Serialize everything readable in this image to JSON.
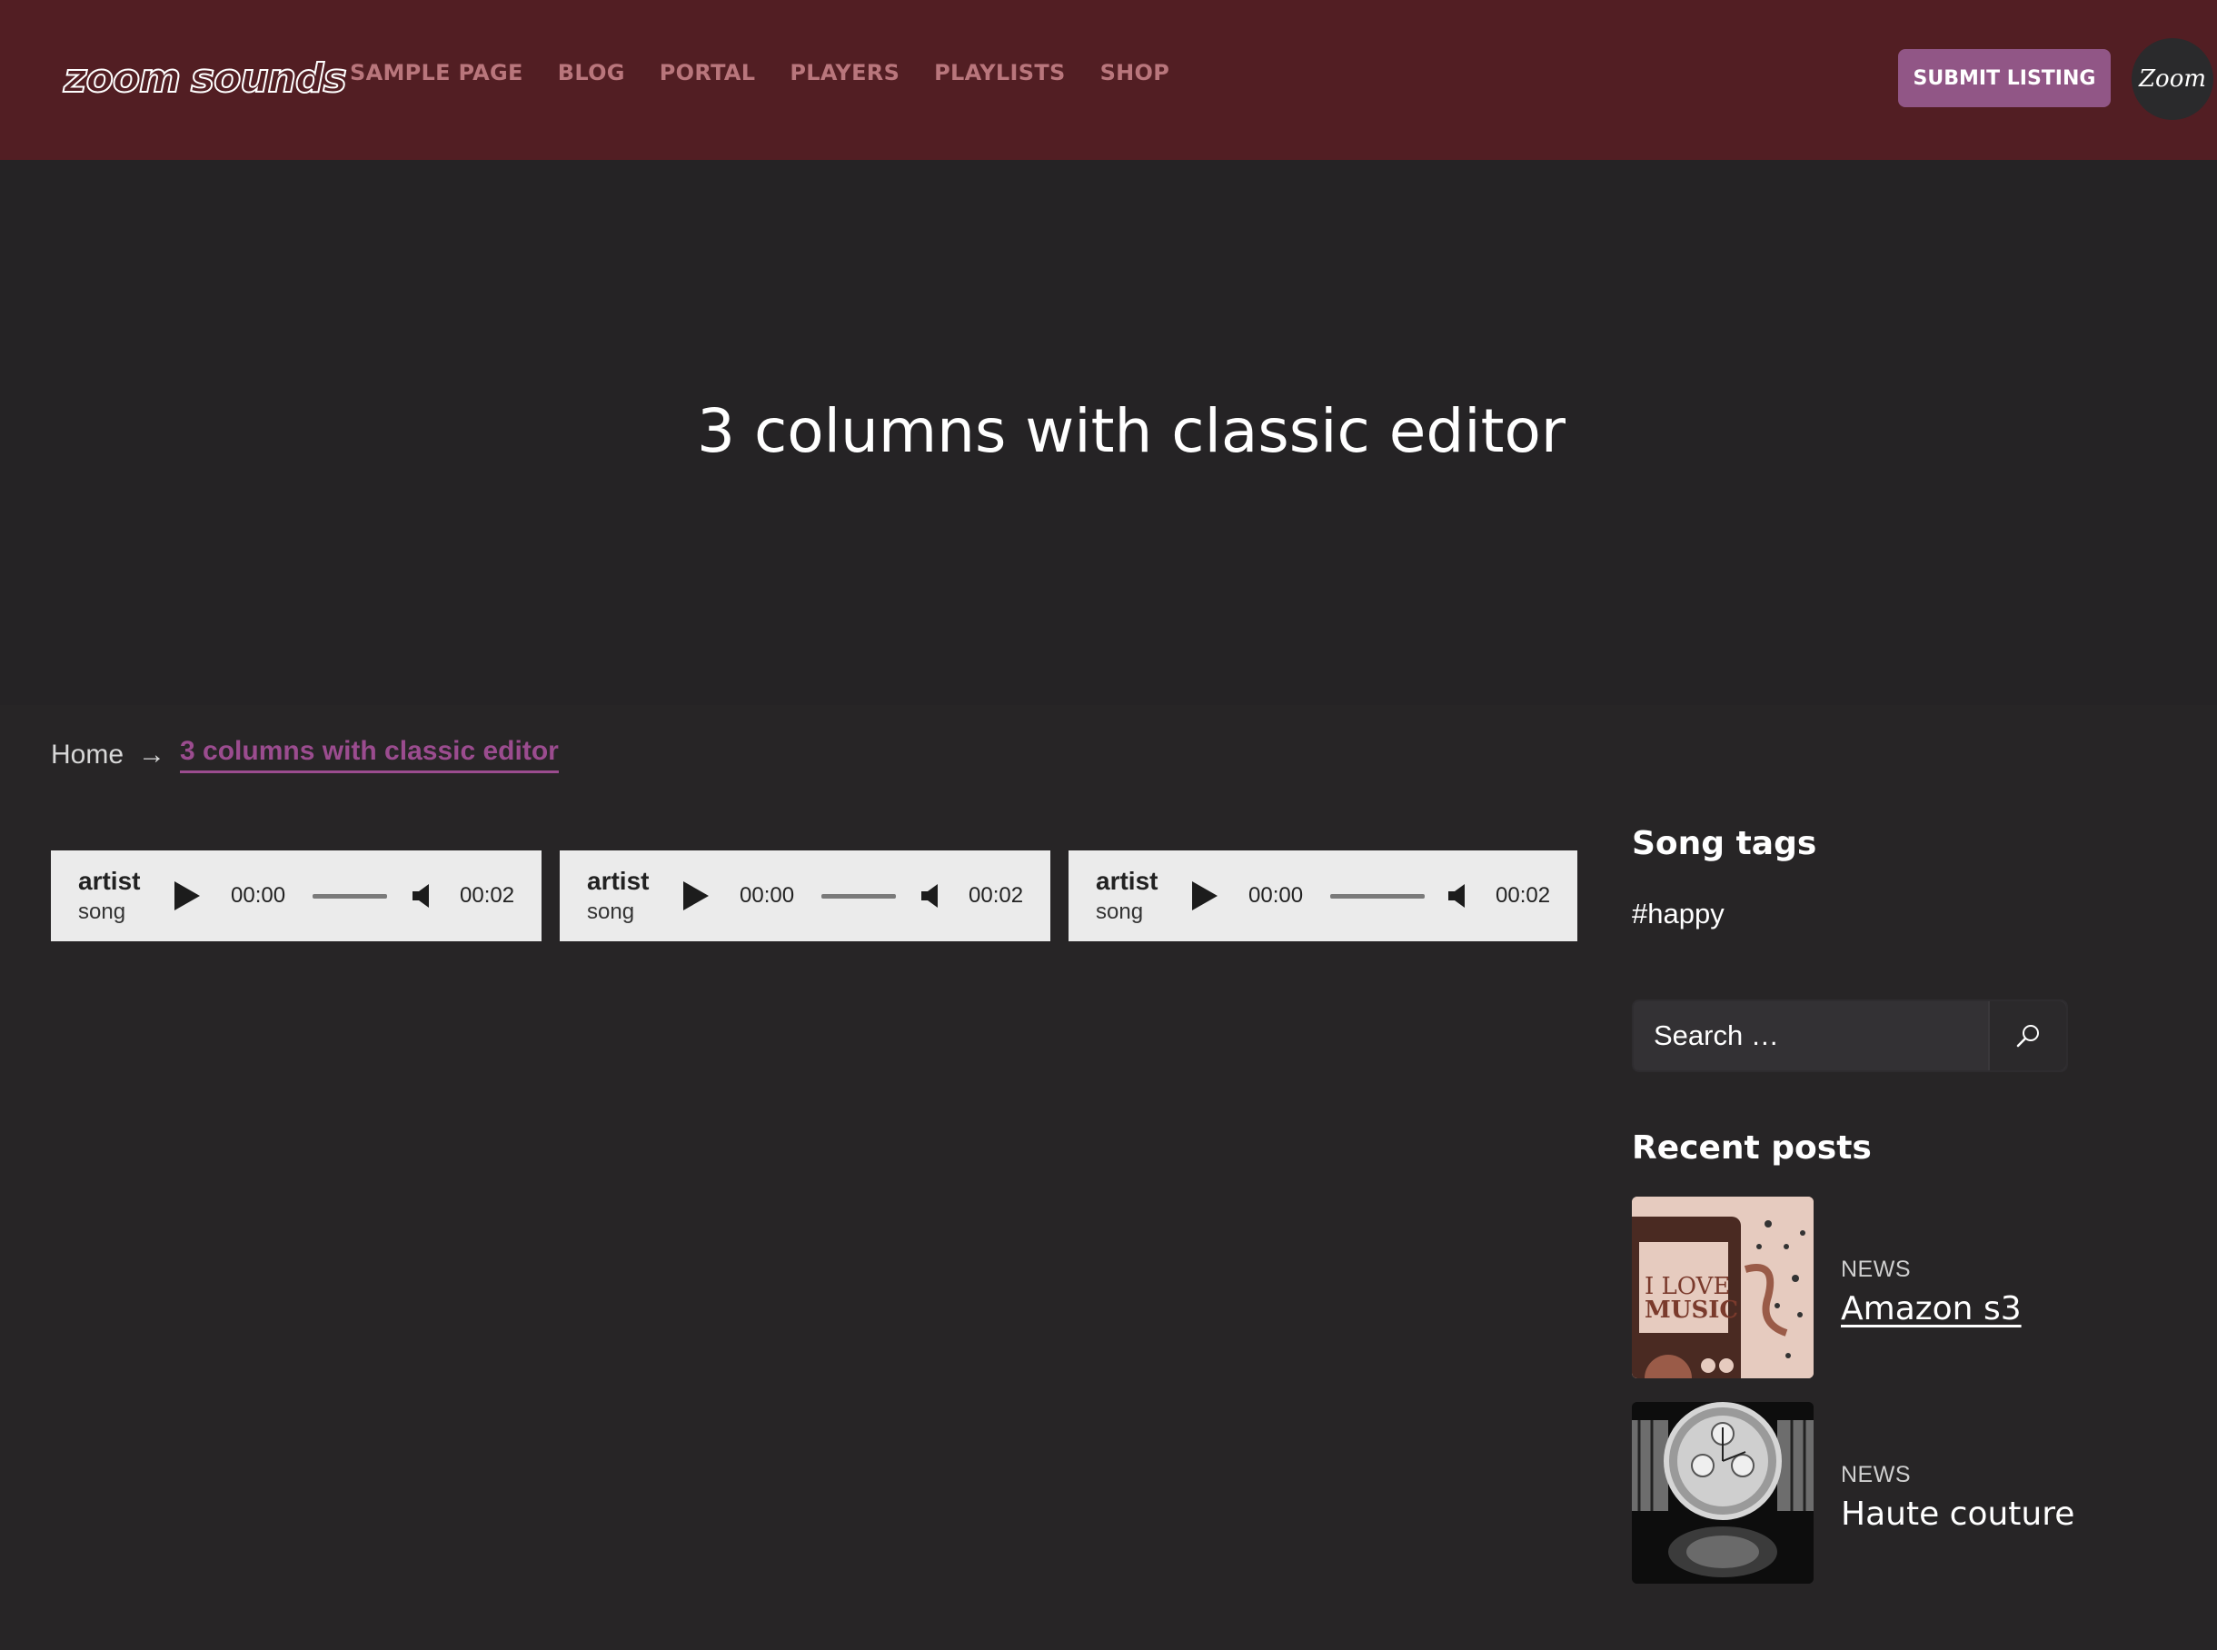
{
  "header": {
    "logo_left": "zoom",
    "logo_right": "sounds",
    "nav": [
      "SAMPLE PAGE",
      "BLOG",
      "PORTAL",
      "PLAYERS",
      "PLAYLISTS",
      "SHOP"
    ],
    "submit_label": "SUBMIT LISTING",
    "avatar_text": "Zoom"
  },
  "hero": {
    "title": "3 columns with classic editor"
  },
  "breadcrumb": {
    "home": "Home",
    "arrow": "→",
    "current": "3 columns with classic editor"
  },
  "players": [
    {
      "artist": "artist",
      "song": "song",
      "current_time": "00:00",
      "duration": "00:02"
    },
    {
      "artist": "artist",
      "song": "song",
      "current_time": "00:00",
      "duration": "00:02"
    },
    {
      "artist": "artist",
      "song": "song",
      "current_time": "00:00",
      "duration": "00:02"
    }
  ],
  "sidebar": {
    "song_tags_title": "Song tags",
    "tags": [
      "#happy"
    ],
    "search_placeholder": "Search …",
    "recent_posts_title": "Recent posts",
    "posts": [
      {
        "category": "NEWS",
        "title": "Amazon s3",
        "thumb_text_1": "I LOVE",
        "thumb_text_2": "MUSIC"
      },
      {
        "category": "NEWS",
        "title": "Haute couture"
      }
    ]
  },
  "colors": {
    "header_bg": "#521e23",
    "page_bg": "#272526",
    "accent": "#915686",
    "nav_text": "#b9767c"
  },
  "icons": {
    "search": "search-icon",
    "play": "play-icon",
    "volume": "volume-icon"
  }
}
